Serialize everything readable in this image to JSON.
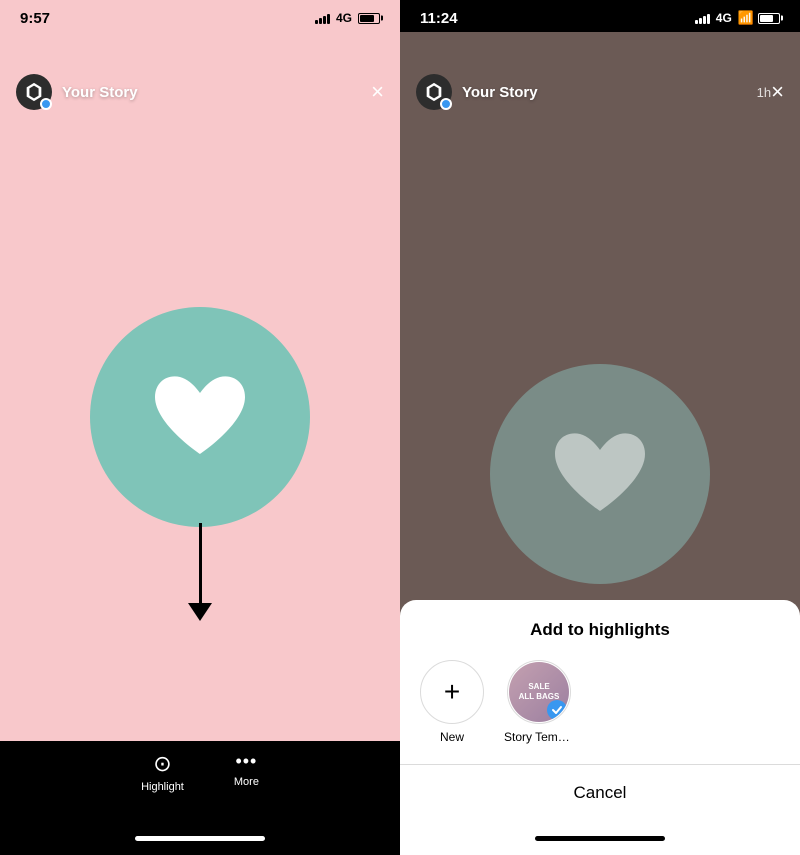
{
  "screen1": {
    "status_time": "9:57",
    "signal": "4G",
    "story_name": "Your Story",
    "close_label": "×",
    "bottom_actions": [
      {
        "id": "highlight",
        "icon": "♡",
        "label": "Highlight"
      },
      {
        "id": "more",
        "icon": "···",
        "label": "More"
      }
    ]
  },
  "screen2": {
    "status_time": "11:24",
    "signal": "4G",
    "story_name": "Your Story",
    "story_time": "1h",
    "close_label": "×",
    "sheet": {
      "title": "Add to highlights",
      "new_label": "New",
      "template_label": "Story Templ...",
      "cancel_label": "Cancel"
    }
  }
}
